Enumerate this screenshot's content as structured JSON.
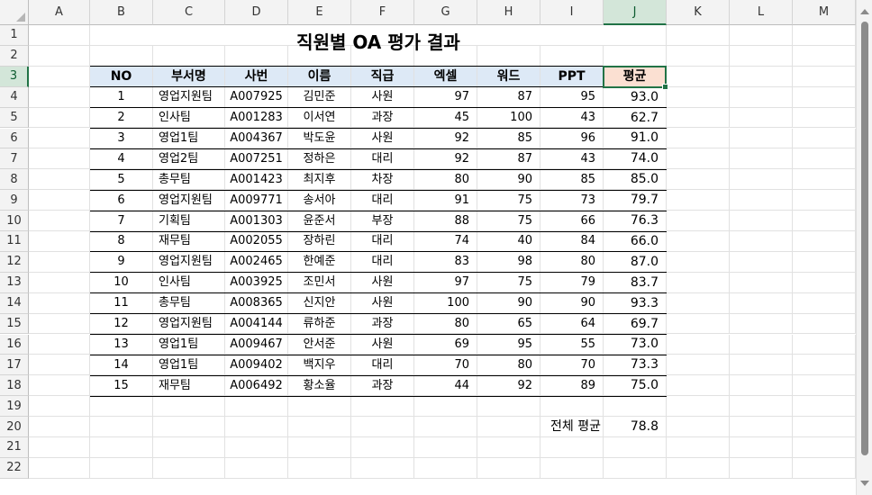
{
  "columns": [
    "A",
    "B",
    "C",
    "D",
    "E",
    "F",
    "G",
    "H",
    "I",
    "J",
    "K",
    "L",
    "M"
  ],
  "rows": [
    "1",
    "2",
    "3",
    "4",
    "5",
    "6",
    "7",
    "8",
    "9",
    "10",
    "11",
    "12",
    "13",
    "14",
    "15",
    "16",
    "17",
    "18",
    "19",
    "20",
    "21",
    "22"
  ],
  "selected_cell": "J3",
  "title": "직원별 OA 평가 결과",
  "headers": [
    "NO",
    "부서명",
    "사번",
    "이름",
    "직급",
    "엑셀",
    "워드",
    "PPT",
    "평균"
  ],
  "records": [
    [
      "1",
      "영업지원팀",
      "A007925",
      "김민준",
      "사원",
      "97",
      "87",
      "95",
      "93.0"
    ],
    [
      "2",
      "인사팀",
      "A001283",
      "이서연",
      "과장",
      "45",
      "100",
      "43",
      "62.7"
    ],
    [
      "3",
      "영업1팀",
      "A004367",
      "박도윤",
      "사원",
      "92",
      "85",
      "96",
      "91.0"
    ],
    [
      "4",
      "영업2팀",
      "A007251",
      "정하은",
      "대리",
      "92",
      "87",
      "43",
      "74.0"
    ],
    [
      "5",
      "총무팀",
      "A001423",
      "최지후",
      "차장",
      "80",
      "90",
      "85",
      "85.0"
    ],
    [
      "6",
      "영업지원팀",
      "A009771",
      "송서아",
      "대리",
      "91",
      "75",
      "73",
      "79.7"
    ],
    [
      "7",
      "기획팀",
      "A001303",
      "윤준서",
      "부장",
      "88",
      "75",
      "66",
      "76.3"
    ],
    [
      "8",
      "재무팀",
      "A002055",
      "장하린",
      "대리",
      "74",
      "40",
      "84",
      "66.0"
    ],
    [
      "9",
      "영업지원팀",
      "A002465",
      "한예준",
      "대리",
      "83",
      "98",
      "80",
      "87.0"
    ],
    [
      "10",
      "인사팀",
      "A003925",
      "조민서",
      "사원",
      "97",
      "75",
      "79",
      "83.7"
    ],
    [
      "11",
      "총무팀",
      "A008365",
      "신지안",
      "사원",
      "100",
      "90",
      "90",
      "93.3"
    ],
    [
      "12",
      "영업지원팀",
      "A004144",
      "류하준",
      "과장",
      "80",
      "65",
      "64",
      "69.7"
    ],
    [
      "13",
      "영업1팀",
      "A009467",
      "안서준",
      "사원",
      "69",
      "95",
      "55",
      "73.0"
    ],
    [
      "14",
      "영업1팀",
      "A009402",
      "백지우",
      "대리",
      "70",
      "80",
      "70",
      "73.3"
    ],
    [
      "15",
      "재무팀",
      "A006492",
      "황소율",
      "과장",
      "44",
      "92",
      "89",
      "75.0"
    ]
  ],
  "summary": {
    "label": "전체 평균",
    "value": "78.8"
  },
  "colors": {
    "header_fill": "#dde9f6",
    "avg_header_fill": "#fbe0d2",
    "selection": "#217346"
  }
}
